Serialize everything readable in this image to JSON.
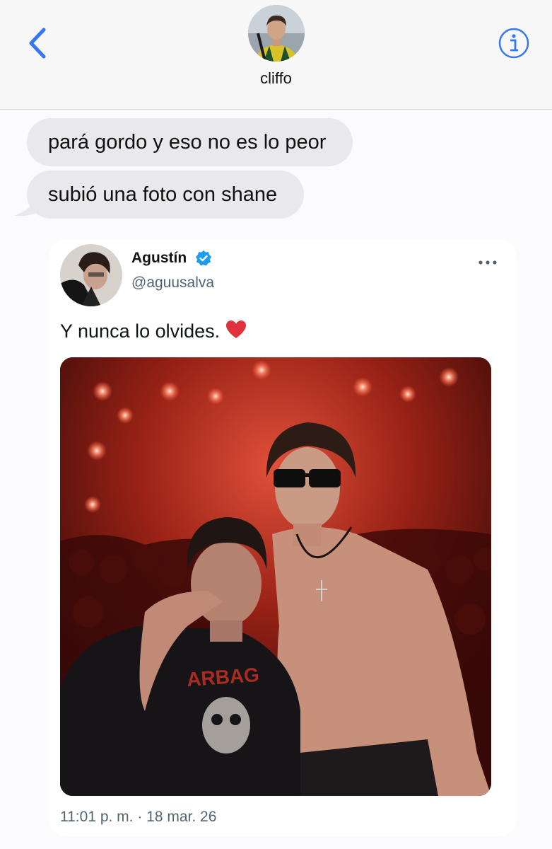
{
  "header": {
    "contact_name": "cliffo",
    "back_icon": "chevron-left-icon",
    "info_icon": "info-circle-icon",
    "accent_color": "#3478f6"
  },
  "messages": [
    {
      "text": "pará gordo y eso no es lo peor"
    },
    {
      "text": "subió una foto con shane"
    }
  ],
  "tweet": {
    "author_name": "Agustín",
    "handle": "@aguusalva",
    "verified": true,
    "text": "Y nunca lo olvides.",
    "emoji_icon": "red-heart-icon",
    "timestamp": "11:01 p. m. · 18 mar. 26",
    "more_icon": "more-horizontal-icon",
    "verified_color": "#1d9bf0"
  }
}
